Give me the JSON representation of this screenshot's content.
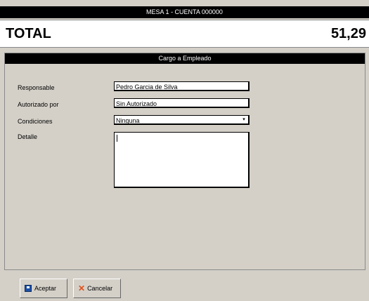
{
  "header": {
    "title": "MESA 1 - CUENTA 000000"
  },
  "total": {
    "label": "TOTAL",
    "value": "51,29"
  },
  "form": {
    "title": "Cargo a Empleado",
    "fields": [
      {
        "label": "Responsable",
        "value": "Pedro Garcia de Silva"
      },
      {
        "label": "Autorizado por",
        "value": "Sin Autorizado"
      },
      {
        "label": "Condiciones",
        "value": "Ninguna"
      },
      {
        "label": "Detalle",
        "value": ""
      }
    ]
  },
  "buttons": {
    "accept": "Aceptar",
    "cancel": "Cancelar"
  },
  "icons": {
    "accept": "save-icon",
    "cancel": "cancel-x-icon",
    "select": "chevron-down-icon"
  },
  "colors": {
    "header_bg": "#000000",
    "panel_bg": "#d4d0c8",
    "cancel_icon": "#e0501b",
    "accept_icon": "#1d4fa5"
  }
}
